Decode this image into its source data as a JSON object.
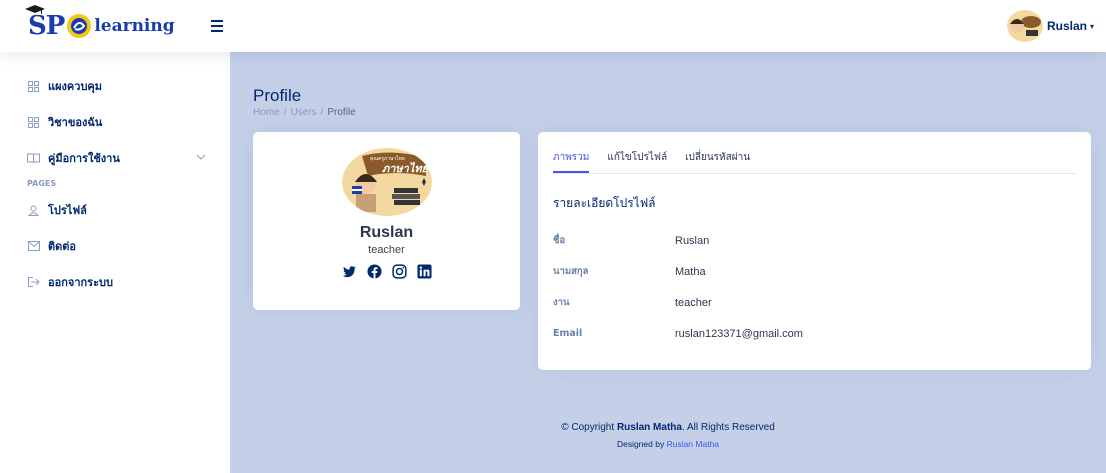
{
  "header": {
    "logo_sp": "SP",
    "logo_learning": "learning",
    "user_name": "Ruslan",
    "caret": "▾"
  },
  "sidebar": {
    "items": [
      {
        "label": "แผงควบคุม",
        "icon": "grid-icon"
      },
      {
        "label": "วิชาของฉัน",
        "icon": "grid-icon"
      },
      {
        "label": "คู่มือการใช้งาน",
        "icon": "book-icon"
      }
    ],
    "heading": "PAGES",
    "pages": [
      {
        "label": "โปรไฟล์",
        "icon": "person-icon"
      },
      {
        "label": "ติดต่อ",
        "icon": "envelope-icon"
      },
      {
        "label": "ออกจากระบบ",
        "icon": "logout-icon"
      }
    ]
  },
  "page": {
    "title": "Profile",
    "breadcrumb": [
      "Home",
      "Users",
      "Profile"
    ]
  },
  "profile_card": {
    "name": "Ruslan",
    "role": "teacher",
    "avatar_text": "ภาษาไทย",
    "avatar_small_text": "คุณครูภาษาไทย"
  },
  "tabs": [
    {
      "label": "ภาพรวม",
      "active": true
    },
    {
      "label": "แก้ไขโปรไฟล์",
      "active": false
    },
    {
      "label": "เปลี่ยนรหัสผ่าน",
      "active": false
    }
  ],
  "details": {
    "title": "รายละเอียดโปรไฟล์",
    "rows": [
      {
        "label": "ชื่อ",
        "value": "Ruslan"
      },
      {
        "label": "นามสกุล",
        "value": "Matha"
      },
      {
        "label": "งาน",
        "value": "teacher"
      },
      {
        "label": "Email",
        "value": "ruslan123371@gmail.com"
      }
    ]
  },
  "footer": {
    "copy_prefix": "© Copyright ",
    "copy_name": "Ruslan Matha",
    "copy_suffix": ". All Rights Reserved",
    "designed_prefix": "Designed by ",
    "designed_name": "Ruslan Matha"
  },
  "colors": {
    "accent": "#4154f1",
    "navy": "#012970",
    "main_bg": "#c5d0e8"
  }
}
